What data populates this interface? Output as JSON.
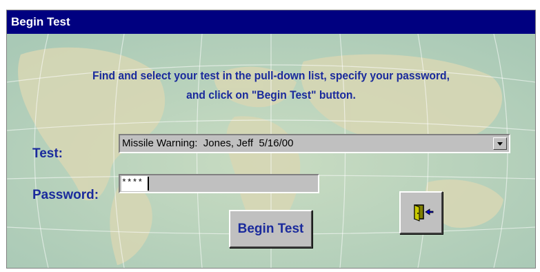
{
  "window": {
    "title": "Begin Test"
  },
  "form": {
    "instructions_line1": "Find and select your test in the pull-down list, specify your password,",
    "instructions_line2": "and click on \"Begin Test\" button.",
    "test_label": "Test:",
    "test_selected": "Missile Warning:  Jones, Jeff  5/16/00",
    "password_label": "Password:",
    "password_value": "****"
  },
  "buttons": {
    "begin_label": "Begin Test",
    "exit_icon": "exit-door-icon"
  },
  "colors": {
    "titlebar": "#000080",
    "label_text": "#1a2a9c",
    "background": "#b7d3b8",
    "control_face": "#c0c0c0"
  }
}
